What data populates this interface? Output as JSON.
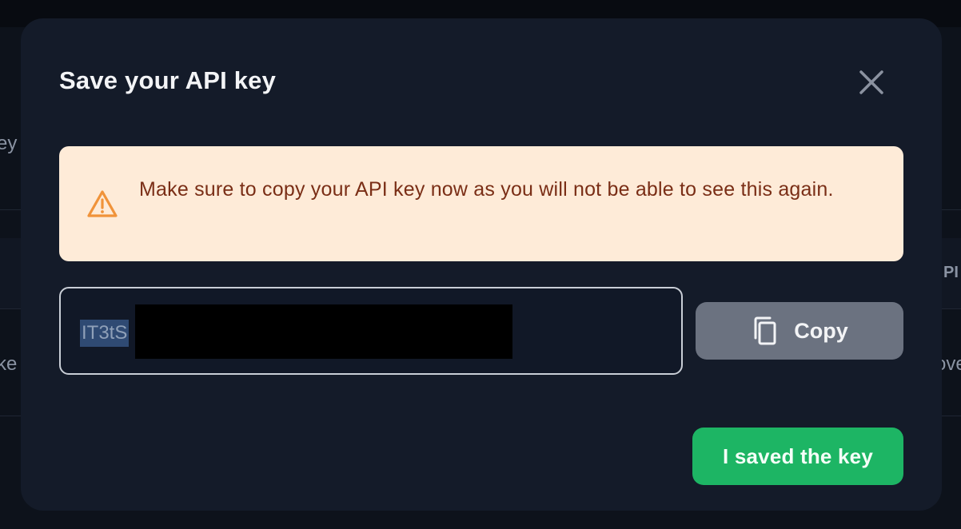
{
  "background": {
    "fragments": [
      {
        "id": "bg-key-label",
        "text": "ey"
      },
      {
        "id": "bg-api-header",
        "text": "PI"
      },
      {
        "id": "bg-key-cell",
        "text": "ke"
      },
      {
        "id": "bg-remove-cell",
        "text": "ove"
      }
    ]
  },
  "modal": {
    "title": "Save your API key",
    "close_icon": "close-icon",
    "warning": {
      "icon": "warning-triangle-icon",
      "text": "Make sure to copy your API key now as you will not be able to see this again.",
      "text_color": "#7a2e16",
      "background": "#feebd8"
    },
    "key_field": {
      "visible_prefix": "IT3tS",
      "redacted": true
    },
    "copy_button": {
      "label": "Copy",
      "icon": "copy-icon",
      "color": "#6b7280"
    },
    "confirm_button": {
      "label": "I saved the key",
      "color": "#1db564"
    }
  }
}
